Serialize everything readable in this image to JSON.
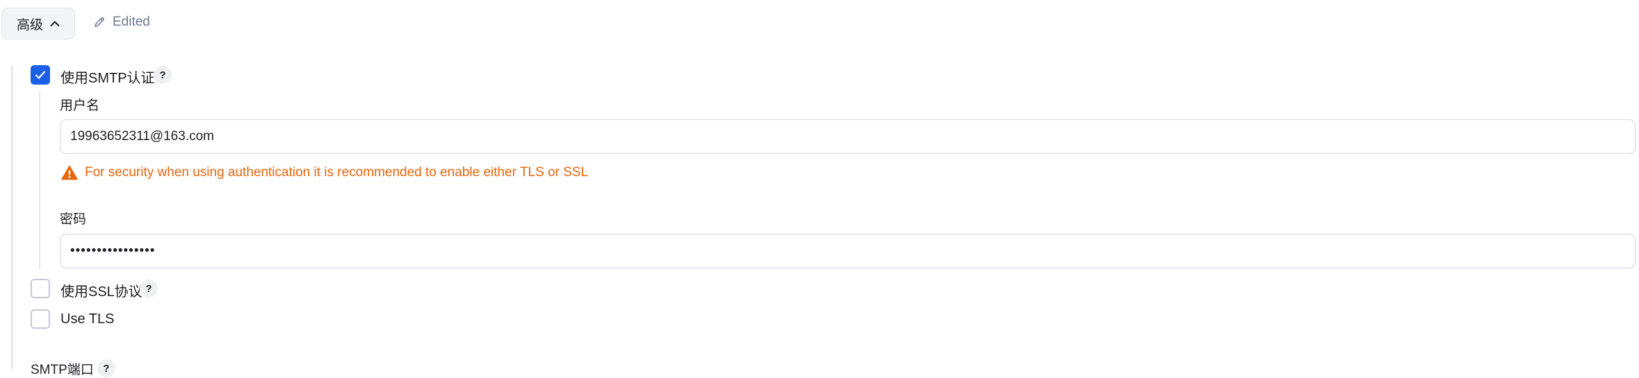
{
  "advanced": {
    "label": "高级",
    "edited_label": "Edited"
  },
  "smtp_auth": {
    "label": "使用SMTP认证",
    "checked": true,
    "help": "?",
    "username": {
      "label": "用户名",
      "value": "19963652311@163.com"
    },
    "warning": "For security when using authentication it is recommended to enable either TLS or SSL",
    "password": {
      "label": "密码",
      "value": "••••••••••••••••"
    }
  },
  "ssl": {
    "label": "使用SSL协议",
    "checked": false,
    "help": "?"
  },
  "tls": {
    "label": "Use TLS",
    "checked": false
  },
  "smtp_port": {
    "label": "SMTP端口",
    "help": "?"
  },
  "colors": {
    "accent": "#1a5fe6",
    "warning": "#e8650c",
    "muted": "#6e7a90"
  }
}
